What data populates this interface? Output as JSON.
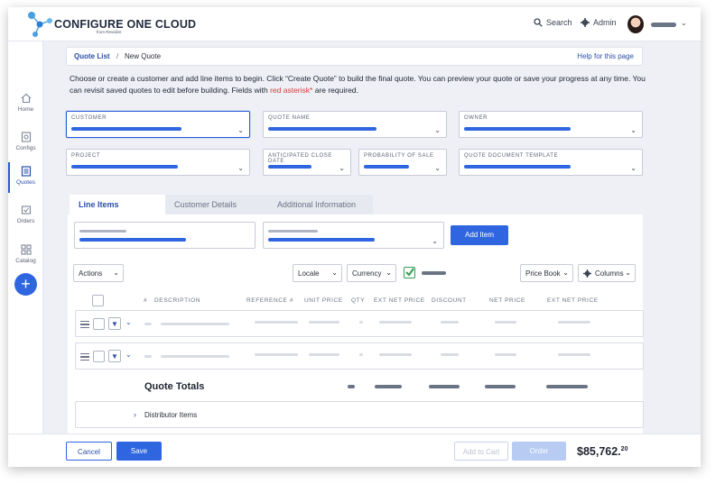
{
  "header": {
    "brand": "CONFIGURE ONE CLOUD",
    "brand_sub": "from Revalize",
    "search": "Search",
    "admin": "Admin"
  },
  "sidebar": {
    "items": [
      {
        "label": "Home",
        "icon": "home-icon"
      },
      {
        "label": "Configs",
        "icon": "configs-icon"
      },
      {
        "label": "Quotes",
        "icon": "quotes-icon"
      },
      {
        "label": "Orders",
        "icon": "orders-icon"
      },
      {
        "label": "Catalog",
        "icon": "catalog-icon"
      }
    ],
    "add": "+"
  },
  "breadcrumb": {
    "quote_list": "Quote List",
    "separator": "/",
    "current": "New Quote",
    "help": "Help for this page"
  },
  "instructions": {
    "text": "Choose or create a customer and add line items to begin. Click “Create Quote” to build the final quote. You can preview your quote or save your progress at any time. You can revisit saved quotes to edit before building. Fields with ",
    "required_text": "red asterisk*",
    "suffix": " are required."
  },
  "form": {
    "customer": "CUSTOMER",
    "quote_name": "QUOTE NAME",
    "owner": "OWNER",
    "project": "PROJECT",
    "close_date": "ANTICIPATED CLOSE DATE",
    "probability": "PROBABILITY OF SALE",
    "template": "QUOTE DOCUMENT TEMPLATE"
  },
  "tabs": [
    "Line Items",
    "Customer Details",
    "Additional Information"
  ],
  "line_items": {
    "add_item": "Add Item",
    "actions": "Actions",
    "locale": "Locale",
    "currency": "Currency",
    "price_book": "Price Book",
    "columns": "Columns",
    "headers": [
      "#",
      "DESCRIPTION",
      "REFERENCE #",
      "UNIT PRICE",
      "QTY",
      "EXT NET PRICE",
      "DISCOUNT",
      "NET PRICE",
      "EXT NET PRICE"
    ],
    "quote_totals": "Quote Totals",
    "distributor_items": "Distributor Items"
  },
  "footer": {
    "cancel": "Cancel",
    "save": "Save",
    "add_to_cart": "Add to Cart",
    "order": "Order",
    "total_main": "$85,762.",
    "total_cents": "20"
  },
  "colors": {
    "accent": "#2f66e0",
    "link": "#2b4fa8",
    "check": "#2e9e4f",
    "required": "#d93a3a"
  }
}
